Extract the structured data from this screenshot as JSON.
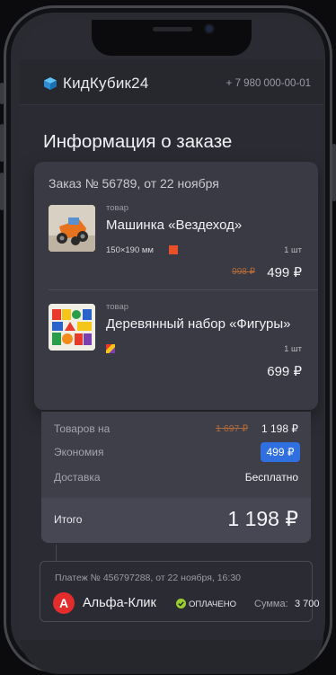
{
  "header": {
    "brand": "КидКубик24",
    "phone": "+ 7 980 000-00-01"
  },
  "page_title": "Информация о заказе",
  "order": {
    "number_line": "Заказ № 56789, от 22 ноября",
    "items": [
      {
        "category": "товар",
        "name": "Машинка «Вездеход»",
        "dims": "150×190 мм",
        "qty": "1 шт",
        "old_price": "998 ₽",
        "price": "499 ₽",
        "swatch_color": "#e8502a",
        "thumb": "toy-car"
      },
      {
        "category": "товар",
        "name": "Деревянный набор «Фигуры»",
        "dims": "",
        "qty": "1 шт",
        "old_price": "",
        "price": "699 ₽",
        "swatch_color": "multicolor",
        "thumb": "wooden-shapes-set"
      }
    ]
  },
  "summary": {
    "goods_label": "Товаров на",
    "goods_old": "1 697 ₽",
    "goods_value": "1 198 ₽",
    "savings_label": "Экономия",
    "savings_value": "499 ₽",
    "delivery_label": "Доставка",
    "delivery_value": "Бесплатно",
    "total_label": "Итого",
    "total_value": "1 198 ₽"
  },
  "payment": {
    "info": "Платеж № 456797288, от 22 ноября, 16:30",
    "bank_letter": "А",
    "method": "Альфа-Клик",
    "status": "ОПЛАЧЕНО",
    "sum_label": "Сумма:",
    "sum_value": "3 700"
  },
  "colors": {
    "accent": "#2f6fe0",
    "old_price": "#b26a3a",
    "bank": "#e32c2c",
    "paid": "#9acd32"
  },
  "icons": {
    "brand": "cube-icon",
    "paid": "check-circle-icon"
  }
}
